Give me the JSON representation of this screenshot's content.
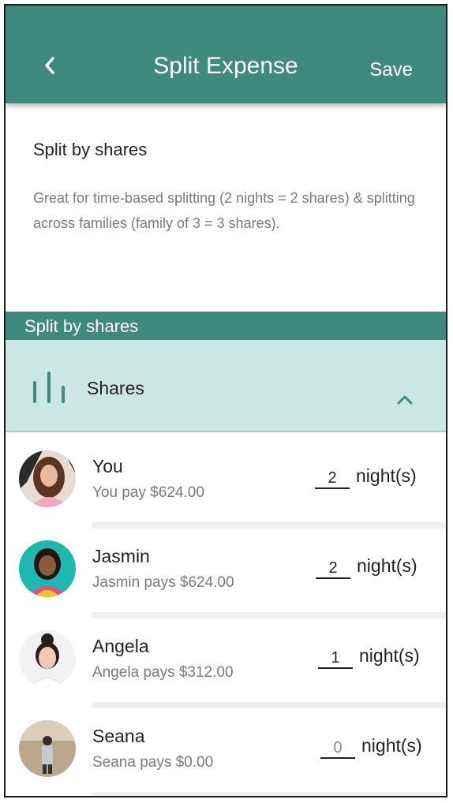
{
  "appbar": {
    "title": "Split Expense",
    "save_label": "Save",
    "color": "#3f8a7c"
  },
  "intro": {
    "heading": "Split by shares",
    "description": "Great for time-based splitting (2 nights = 2 shares) & splitting across families (family of 3 = 3 shares)."
  },
  "section": {
    "header": "Split by shares",
    "selector_label": "Shares",
    "selector_icon": "bar-chart-icon",
    "expand_icon": "chevron-up-icon"
  },
  "people": [
    {
      "name": "You",
      "pays": "You pay $624.00",
      "shares": "2",
      "unit": "night(s)"
    },
    {
      "name": "Jasmin",
      "pays": "Jasmin pays $624.00",
      "shares": "2",
      "unit": "night(s)"
    },
    {
      "name": "Angela",
      "pays": "Angela pays $312.00",
      "shares": "1",
      "unit": "night(s)"
    },
    {
      "name": "Seana",
      "pays": "Seana pays $0.00",
      "shares": "0",
      "unit": "night(s)"
    }
  ]
}
